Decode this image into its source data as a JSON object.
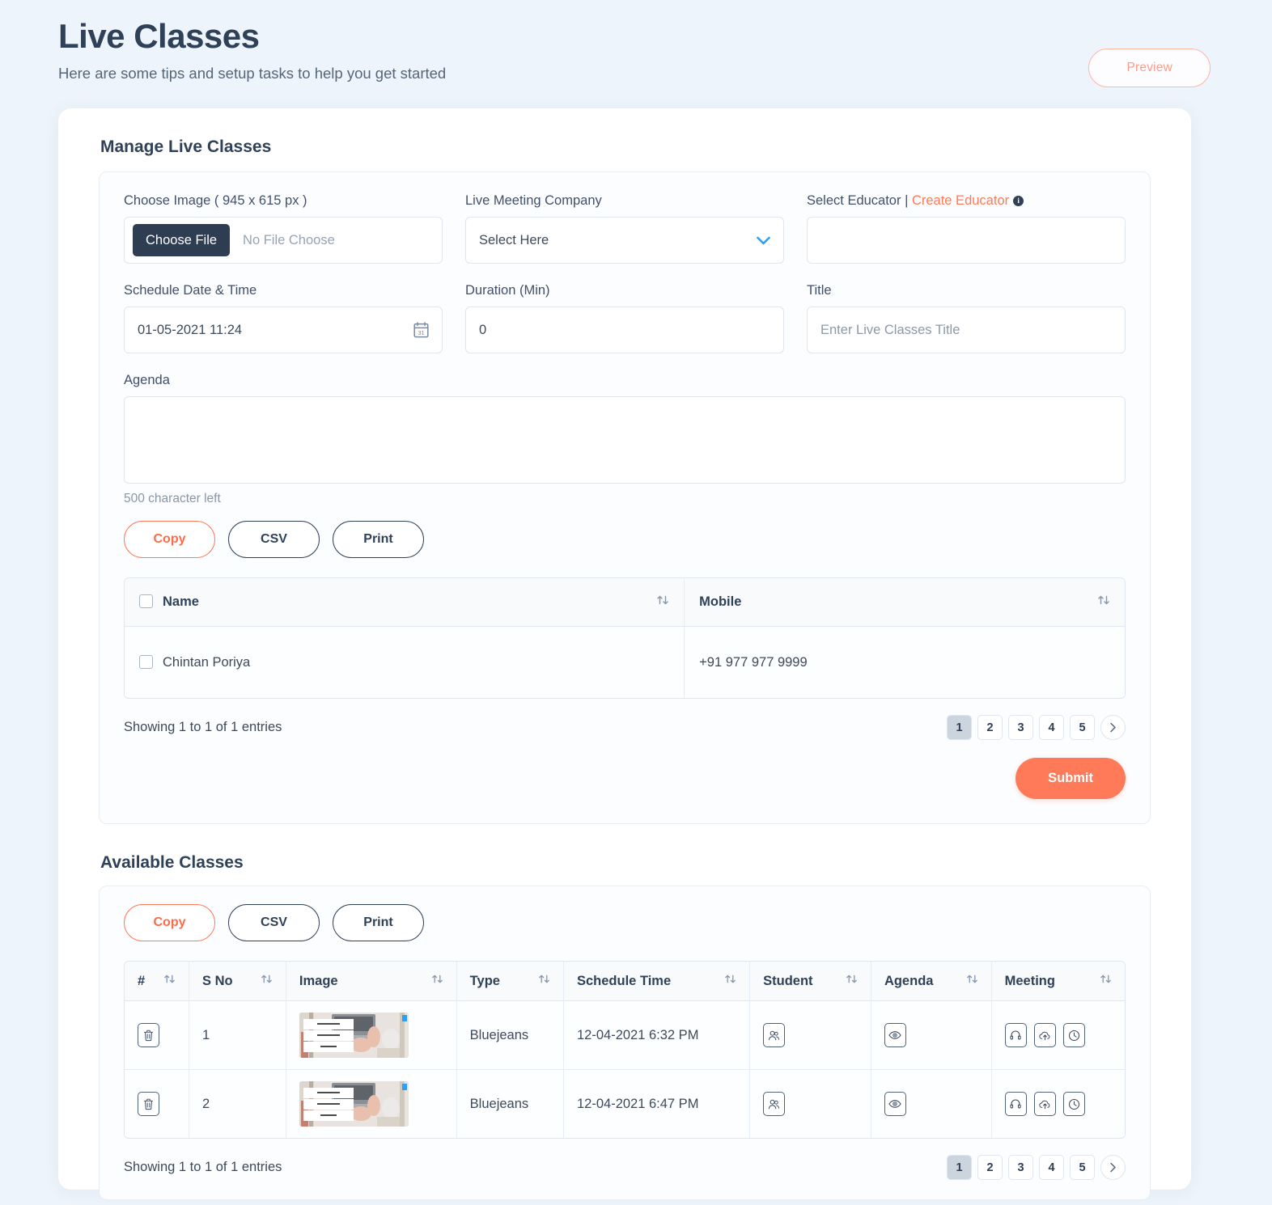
{
  "header": {
    "title": "Live Classes",
    "subtitle": "Here are some tips and setup tasks to help you get started",
    "preview_label": "Preview"
  },
  "manage": {
    "section_title": "Manage Live Classes",
    "choose_image_label": "Choose Image ( 945 x 615 px )",
    "choose_file_button": "Choose File",
    "file_placeholder": "No File Choose",
    "meeting_company_label": "Live Meeting Company",
    "meeting_company_value": "Select Here",
    "educator_label": "Select Educator |",
    "educator_link": "Create Educator",
    "educator_value": "",
    "schedule_label": "Schedule Date & Time",
    "schedule_value": "01-05-2021 11:24",
    "duration_label": "Duration (Min)",
    "duration_value": "0",
    "title_label": "Title",
    "title_placeholder": "Enter Live Classes Title",
    "agenda_label": "Agenda",
    "agenda_value": "",
    "char_left": "500 character left",
    "export": {
      "copy": "Copy",
      "csv": "CSV",
      "print": "Print"
    },
    "table": {
      "columns": [
        "Name",
        "Mobile"
      ],
      "rows": [
        {
          "name": "Chintan Poriya",
          "mobile": "+91 977 977 9999"
        }
      ]
    },
    "entries_text": "Showing 1 to 1 of 1 entries",
    "pagination": {
      "pages": [
        "1",
        "2",
        "3",
        "4",
        "5"
      ],
      "active": "1",
      "next_icon": "chevron-right-icon"
    },
    "submit_label": "Submit"
  },
  "available": {
    "section_title": "Available Classes",
    "export": {
      "copy": "Copy",
      "csv": "CSV",
      "print": "Print"
    },
    "table": {
      "columns": [
        "#",
        "S No",
        "Image",
        "Type",
        "Schedule Time",
        "Student",
        "Agenda",
        "Meeting"
      ],
      "rows": [
        {
          "delete_icon": "trash-icon",
          "s_no": "1",
          "image": "laptop-hands-thumbnail",
          "type": "Bluejeans",
          "schedule_time": "12-04-2021 6:32 PM",
          "student_icon": "users-icon",
          "agenda_icon": "eye-icon",
          "meeting_icons": [
            "headset-icon",
            "cloud-upload-icon",
            "clock-icon"
          ]
        },
        {
          "delete_icon": "trash-icon",
          "s_no": "2",
          "image": "laptop-hands-thumbnail",
          "type": "Bluejeans",
          "schedule_time": "12-04-2021 6:47 PM",
          "student_icon": "users-icon",
          "agenda_icon": "eye-icon",
          "meeting_icons": [
            "headset-icon",
            "cloud-upload-icon",
            "clock-icon"
          ]
        }
      ]
    },
    "entries_text": "Showing 1 to 1 of 1 entries",
    "pagination": {
      "pages": [
        "1",
        "2",
        "3",
        "4",
        "5"
      ],
      "active": "1",
      "next_icon": "chevron-right-icon"
    }
  },
  "colors": {
    "page_background": "#eef4fb",
    "accent_orange": "#ff7a59",
    "dark_navy": "#2f4158",
    "chevron_blue": "#2e9ff5"
  }
}
